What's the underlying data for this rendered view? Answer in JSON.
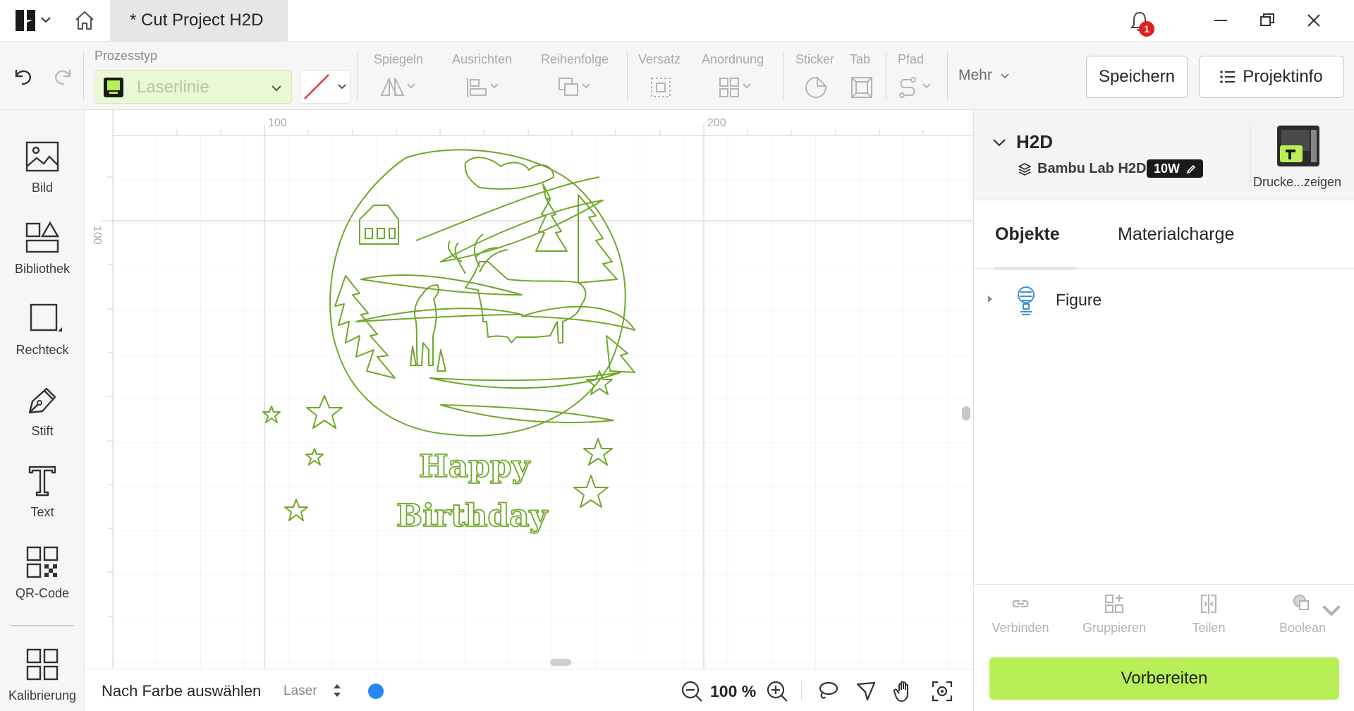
{
  "titlebar": {
    "tab_title": "* Cut Project H2D",
    "notification_count": "1"
  },
  "toolbar": {
    "process_type_label": "Prozesstyp",
    "process_type_value": "Laserlinie",
    "groups": {
      "mirror": "Spiegeln",
      "align": "Ausrichten",
      "order": "Reihenfolge",
      "offset": "Versatz",
      "arrange": "Anordnung",
      "sticker": "Sticker",
      "tab": "Tab",
      "path": "Pfad"
    },
    "more_label": "Mehr",
    "save_label": "Speichern",
    "project_info_label": "Projektinfo"
  },
  "sidebar": {
    "items": [
      {
        "label": "Bild"
      },
      {
        "label": "Bibliothek"
      },
      {
        "label": "Rechteck"
      },
      {
        "label": "Stift"
      },
      {
        "label": "Text"
      },
      {
        "label": "QR-Code"
      },
      {
        "label": "Kalibrierung"
      }
    ]
  },
  "canvas": {
    "ruler_h": [
      "100",
      "200"
    ],
    "ruler_v": [
      "100"
    ],
    "design_color": "#6fa82a"
  },
  "bottombar": {
    "select_by_color": "Nach Farbe auswählen",
    "laser_label": "Laser",
    "laser_color": "#2787f5",
    "zoom": "100 %"
  },
  "panel": {
    "printer_name": "H2D",
    "printer_model": "Bambu Lab H2D",
    "printer_power": "10W",
    "device_button_label": "Drucke...zeigen",
    "tabs": [
      "Objekte",
      "Materialcharge"
    ],
    "objects": [
      {
        "label": "Figure"
      }
    ],
    "actions": [
      "Verbinden",
      "Gruppieren",
      "Teilen",
      "Boolean"
    ],
    "prepare_label": "Vorbereiten"
  },
  "colors": {
    "accent": "#b8ef57",
    "notification": "#e02020"
  }
}
